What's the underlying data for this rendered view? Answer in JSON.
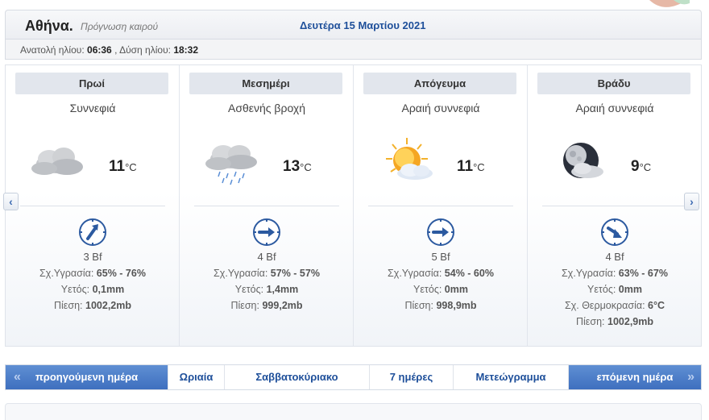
{
  "header": {
    "city": "Αθήνα.",
    "subtitle": "Πρόγνωση καιρού",
    "date": "Δευτέρα 15 Μαρτίου 2021"
  },
  "sun": {
    "sunrise_label": "Ανατολή ηλίου:",
    "sunrise": "06:36",
    "sunset_label": ", Δύση ηλίου:",
    "sunset": "18:32"
  },
  "periods": [
    {
      "title": "Πρωί",
      "condition": "Συννεφιά",
      "temp": "11",
      "unit": "°C",
      "icon": "cloudy-icon",
      "wind_dir": "north-east",
      "bf": "3 Bf",
      "humidity_label": "Σχ.Υγρασία:",
      "humidity": "65% - 76%",
      "rain_label": "Υετός:",
      "rain": "0,1mm",
      "pressure_label": "Πίεση:",
      "pressure": "1002,2mb"
    },
    {
      "title": "Μεσημέρι",
      "condition": "Ασθενής βροχή",
      "temp": "13",
      "unit": "°C",
      "icon": "rain-icon",
      "wind_dir": "east",
      "bf": "4 Bf",
      "humidity_label": "Σχ.Υγρασία:",
      "humidity": "57% - 57%",
      "rain_label": "Υετός:",
      "rain": "1,4mm",
      "pressure_label": "Πίεση:",
      "pressure": "999,2mb"
    },
    {
      "title": "Απόγευμα",
      "condition": "Αραιή συννεφιά",
      "temp": "11",
      "unit": "°C",
      "icon": "partly-sunny-icon",
      "wind_dir": "east",
      "bf": "5 Bf",
      "humidity_label": "Σχ.Υγρασία:",
      "humidity": "54% - 60%",
      "rain_label": "Υετός:",
      "rain": "0mm",
      "pressure_label": "Πίεση:",
      "pressure": "998,9mb"
    },
    {
      "title": "Βράδυ",
      "condition": "Αραιή συννεφιά",
      "temp": "9",
      "unit": "°C",
      "icon": "night-cloudy-icon",
      "wind_dir": "south-east",
      "bf": "4 Bf",
      "humidity_label": "Σχ.Υγρασία:",
      "humidity": "63% - 67%",
      "rain_label": "Υετός:",
      "rain": "0mm",
      "feels_label": "Σχ. Θερμοκρασία:",
      "feels": "6°C",
      "pressure_label": "Πίεση:",
      "pressure": "1002,9mb"
    }
  ],
  "nav": {
    "prev": "προηγούμενη ημέρα",
    "hourly": "Ωριαία",
    "weekend": "Σαββατοκύριακο",
    "week": "7 ημέρες",
    "meteogram": "Μετεώγραμμα",
    "next": "επόμενη ημέρα"
  },
  "colors": {
    "accent": "#1e4f9a",
    "nav_blue": "#4a7bc8"
  }
}
